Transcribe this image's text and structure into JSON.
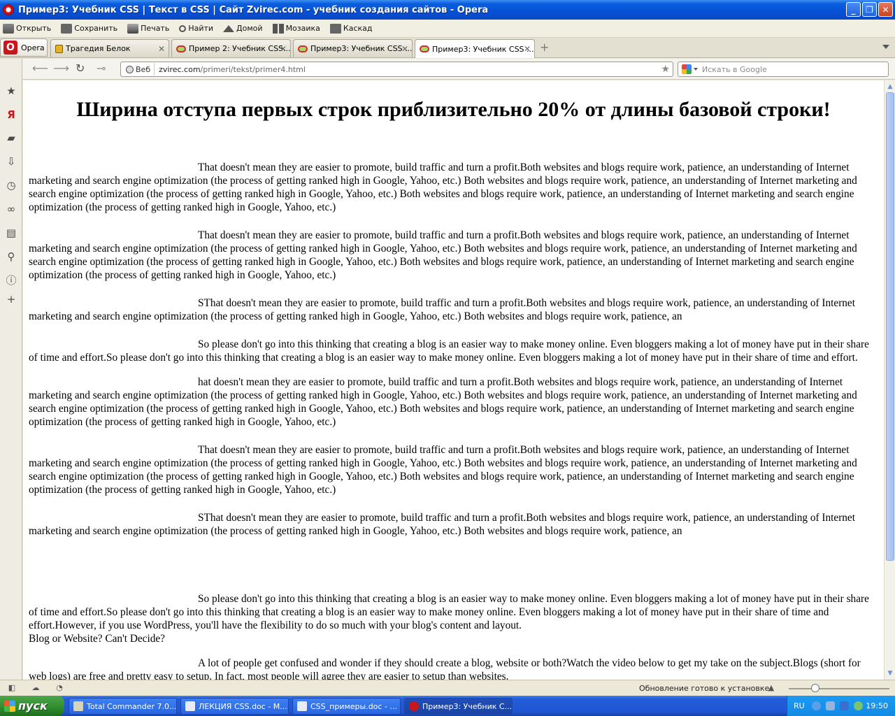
{
  "window": {
    "title": "Пример3: Учебник CSS | Текст в CSS | Сайт Zvirec.com - учебник создания сайтов - Opera"
  },
  "menu": [
    {
      "label": "Открыть",
      "icon": "folder-icon"
    },
    {
      "label": "Сохранить",
      "icon": "save-icon"
    },
    {
      "label": "Печать",
      "icon": "print-icon"
    },
    {
      "label": "Найти",
      "icon": "search-icon"
    },
    {
      "label": "Домой",
      "icon": "home-icon"
    },
    {
      "label": "Мозаика",
      "icon": "tile-icon"
    },
    {
      "label": "Каскад",
      "icon": "cascade-icon"
    }
  ],
  "opera_button": {
    "label": "Opera"
  },
  "tabs": [
    {
      "label": "Трагедия Белок"
    },
    {
      "label": "Пример 2: Учебник CSS..."
    },
    {
      "label": "Пример3: Учебник CSS ..."
    },
    {
      "label": "Пример3: Учебник CSS ..."
    }
  ],
  "address": {
    "badge": "Веб",
    "url_host": "zvirec.com",
    "url_path": "/primeri/tekst/primer4.html"
  },
  "search": {
    "placeholder": "Искать в Google"
  },
  "page": {
    "heading": "Ширина отступа первых строк приблизительно 20% от длины базовой строки!",
    "paragraphs": [
      "That doesn't mean they are easier to promote, build traffic and turn a profit.Both websites and blogs require work, patience, an understanding of Internet marketing and search engine optimization (the process of getting ranked high in Google, Yahoo, etc.) Both websites and blogs require work, patience, an understanding of Internet marketing and search engine optimization (the process of getting ranked high in Google, Yahoo, etc.) Both websites and blogs require work, patience, an understanding of Internet marketing and search engine optimization (the process of getting ranked high in Google, Yahoo, etc.)",
      "That doesn't mean they are easier to promote, build traffic and turn a profit.Both websites and blogs require work, patience, an understanding of Internet marketing and search engine optimization (the process of getting ranked high in Google, Yahoo, etc.) Both websites and blogs require work, patience, an understanding of Internet marketing and search engine optimization (the process of getting ranked high in Google, Yahoo, etc.) Both websites and blogs require work, patience, an understanding of Internet marketing and search engine optimization (the process of getting ranked high in Google, Yahoo, etc.)",
      "SThat doesn't mean they are easier to promote, build traffic and turn a profit.Both websites and blogs require work, patience, an understanding of Internet marketing and search engine optimization (the process of getting ranked high in Google, Yahoo, etc.) Both websites and blogs require work, patience, an",
      "So please don't go into this thinking that creating a blog is an easier way to make money online. Even bloggers making a lot of money have put in their share of time and effort.So please don't go into this thinking that creating a blog is an easier way to make money online. Even bloggers making a lot of money have put in their share of time and effort.",
      "hat doesn't mean they are easier to promote, build traffic and turn a profit.Both websites and blogs require work, patience, an understanding of Internet marketing and search engine optimization (the process of getting ranked high in Google, Yahoo, etc.) Both websites and blogs require work, patience, an understanding of Internet marketing and search engine optimization (the process of getting ranked high in Google, Yahoo, etc.) Both websites and blogs require work, patience, an understanding of Internet marketing and search engine optimization (the process of getting ranked high in Google, Yahoo, etc.)",
      "That doesn't mean they are easier to promote, build traffic and turn a profit.Both websites and blogs require work, patience, an understanding of Internet marketing and search engine optimization (the process of getting ranked high in Google, Yahoo, etc.) Both websites and blogs require work, patience, an understanding of Internet marketing and search engine optimization (the process of getting ranked high in Google, Yahoo, etc.) Both websites and blogs require work, patience, an understanding of Internet marketing and search engine optimization (the process of getting ranked high in Google, Yahoo, etc.)",
      "SThat doesn't mean they are easier to promote, build traffic and turn a profit.Both websites and blogs require work, patience, an understanding of Internet marketing and search engine optimization (the process of getting ranked high in Google, Yahoo, etc.) Both websites and blogs require work, patience, an",
      "So please don't go into this thinking that creating a blog is an easier way to make money online. Even bloggers making a lot of money have put in their share of time and effort.So please don't go into this thinking that creating a blog is an easier way to make money online. Even bloggers making a lot of money have put in their share of time and effort.However, if you use WordPress, you'll have the flexibility to do so much with your blog's content and layout.",
      "A lot of people get confused and wonder if they should create a blog, website or both?Watch the video below to get my take on the subject.Blogs (short for web logs) are free and pretty easy to setup. In fact, most people will agree they are easier to setup than websites."
    ],
    "plain_line": "Blog or Website? Can't Decide?"
  },
  "status": {
    "text": "Обновление готово к установке"
  },
  "taskbar": {
    "start": "пуск",
    "tasks": [
      {
        "label": "Total Commander 7.0..."
      },
      {
        "label": "ЛЕКЦИЯ CSS.doc - M..."
      },
      {
        "label": "CSS_примеры.doc - ..."
      },
      {
        "label": "Пример3: Учебник C..."
      }
    ],
    "lang": "RU",
    "clock": "19:50"
  }
}
